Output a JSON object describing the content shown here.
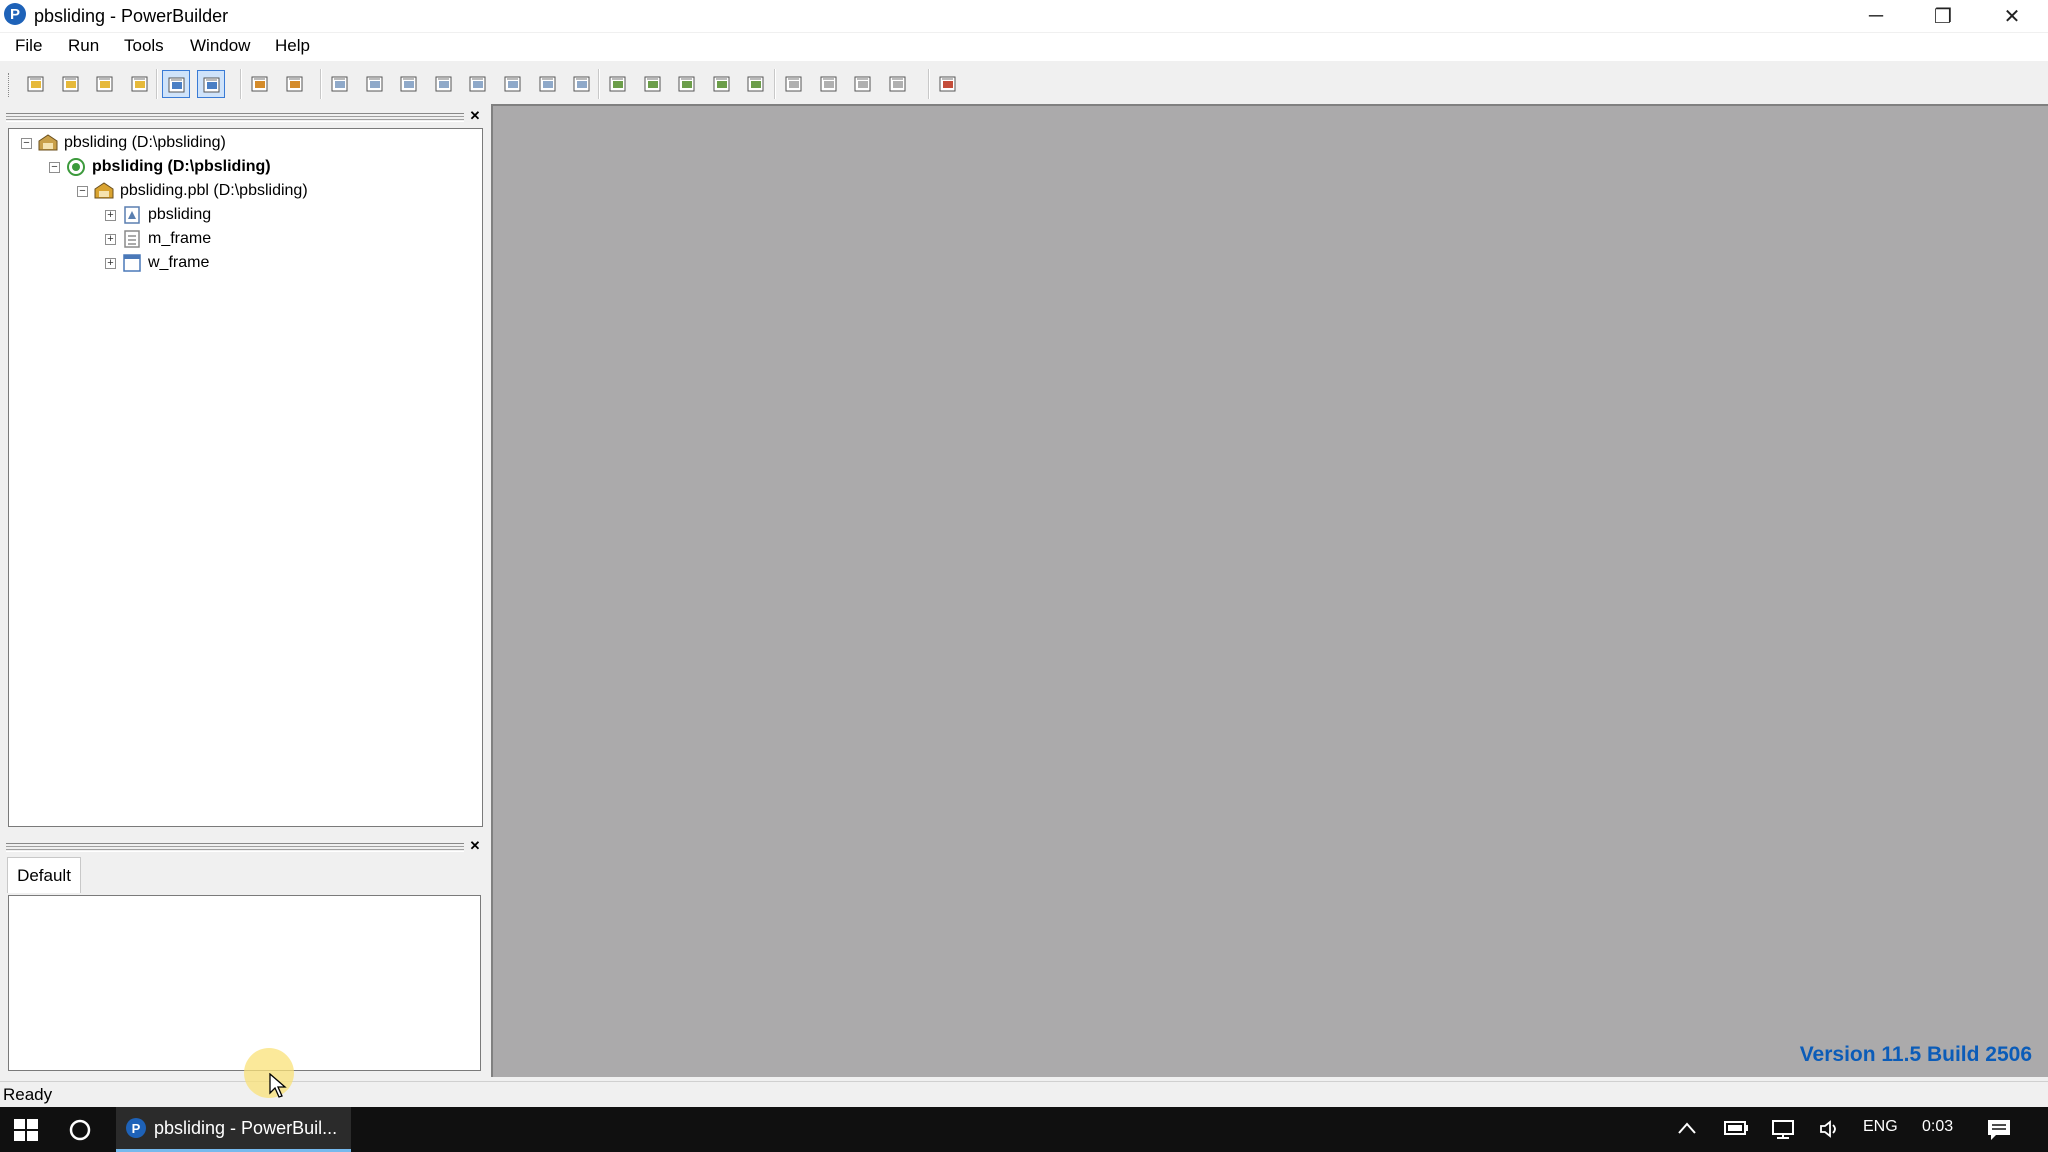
{
  "window": {
    "title": "pbsliding - PowerBuilder",
    "app_icon_glyph": "P",
    "controls": {
      "minimize": "─",
      "maximize": "❐",
      "close": "✕"
    }
  },
  "menu": [
    "File",
    "Run",
    "Tools",
    "Window",
    "Help"
  ],
  "toolbar": {
    "groups": [
      [
        "new-icon",
        "inherit-icon",
        "open-icon",
        "library-painter-icon"
      ],
      [
        "system-tree-icon",
        "output-view-icon"
      ],
      [
        "build-icon",
        "deploy-icon"
      ],
      [
        "script-icon",
        "object-browser-icon",
        "database-profile-icon",
        "sql-icon",
        "database-icon",
        "pipeline-icon",
        "db-table-icon",
        "edit-source-icon"
      ],
      [
        "file-editor-icon",
        "exec-icon",
        "run-window-icon",
        "debug-icon",
        "debug-attach-icon"
      ],
      [
        "run-icon",
        "select-run-icon",
        "run-stop-icon",
        "run-debug-icon"
      ],
      [
        "exit-icon"
      ]
    ],
    "pressed": [
      "system-tree-icon",
      "output-view-icon"
    ]
  },
  "tree": {
    "nodes": [
      {
        "label": "pbsliding (D:\\pbsliding)",
        "level": 0,
        "icon": "workspace-icon",
        "expander": "−",
        "bold": false
      },
      {
        "label": "pbsliding (D:\\pbsliding)",
        "level": 1,
        "icon": "target-icon",
        "expander": "−",
        "bold": true
      },
      {
        "label": "pbsliding.pbl (D:\\pbsliding)",
        "level": 2,
        "icon": "library-icon",
        "expander": "−",
        "bold": false
      },
      {
        "label": "pbsliding",
        "level": 3,
        "icon": "application-icon",
        "expander": "+",
        "bold": false
      },
      {
        "label": "m_frame",
        "level": 3,
        "icon": "menu-object-icon",
        "expander": "+",
        "bold": false
      },
      {
        "label": "w_frame",
        "level": 3,
        "icon": "window-object-icon",
        "expander": "+",
        "bold": false
      }
    ]
  },
  "output_panel": {
    "tab_label": "Default"
  },
  "mdi": {
    "version_text": "Version 11.5 Build 2506"
  },
  "status": {
    "text": "Ready"
  },
  "taskbar": {
    "app_label": "pbsliding - PowerBuil...",
    "language": "ENG",
    "clock": "0:03"
  },
  "colors": {
    "accent": "#0b5cb8",
    "mdi_bg": "#abaaab",
    "taskbar": "#101010"
  }
}
